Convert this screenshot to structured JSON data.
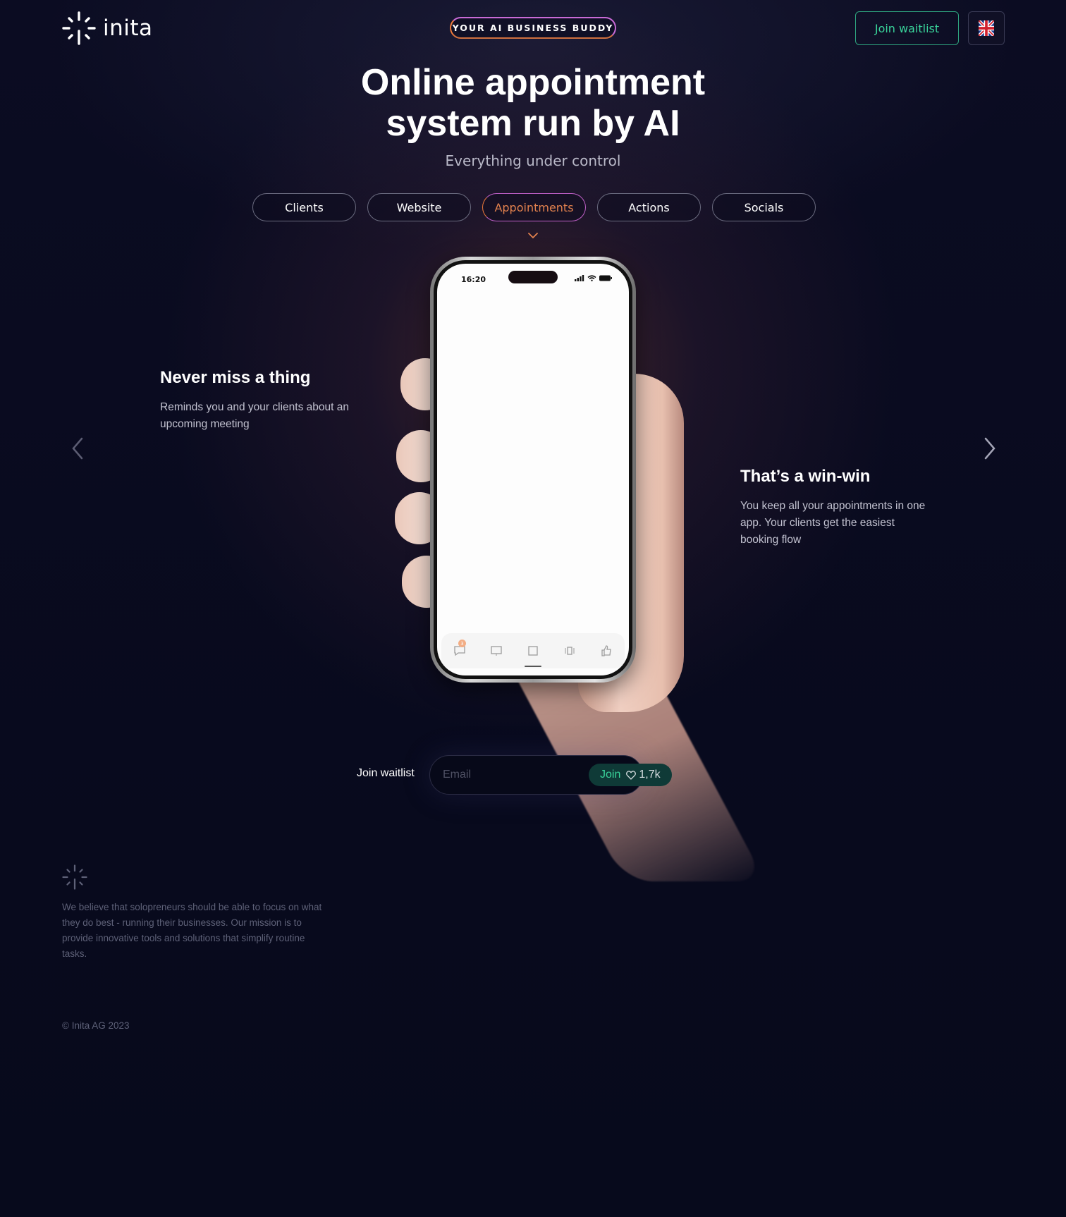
{
  "brand": {
    "name": "inita"
  },
  "header": {
    "badge": "YOUR AI BUSINESS BUDDY",
    "waitlist_button": "Join waitlist",
    "language_icon": "uk-flag-icon"
  },
  "hero": {
    "title_line1": "Online appointment",
    "title_line2": "system run by AI",
    "subtitle": "Everything under control"
  },
  "tabs": [
    {
      "label": "Clients",
      "active": false
    },
    {
      "label": "Website",
      "active": false
    },
    {
      "label": "Appointments",
      "active": true
    },
    {
      "label": "Actions",
      "active": false
    },
    {
      "label": "Socials",
      "active": false
    }
  ],
  "phone": {
    "time": "16:20",
    "notification_count": "3"
  },
  "features": {
    "left": {
      "title": "Never miss a thing",
      "text": "Reminds you and your clients about an upcoming meeting"
    },
    "right": {
      "title": "That’s a win-win",
      "text": "You keep all your appointments in one app. Your clients get the easiest booking flow"
    }
  },
  "waitlist": {
    "label": "Join waitlist",
    "placeholder": "Email",
    "button": "Join",
    "count": "1,7k"
  },
  "footer": {
    "mission": "We believe that solopreneurs should be able to focus on what they do best - running their businesses. Our mission is to provide innovative tools and solutions that simplify routine tasks.",
    "copyright": "© Inita AG 2023"
  },
  "colors": {
    "background": "#080a1d",
    "accent_green": "#39d39a",
    "accent_orange": "#e2814e",
    "accent_purple": "#c060c8"
  }
}
